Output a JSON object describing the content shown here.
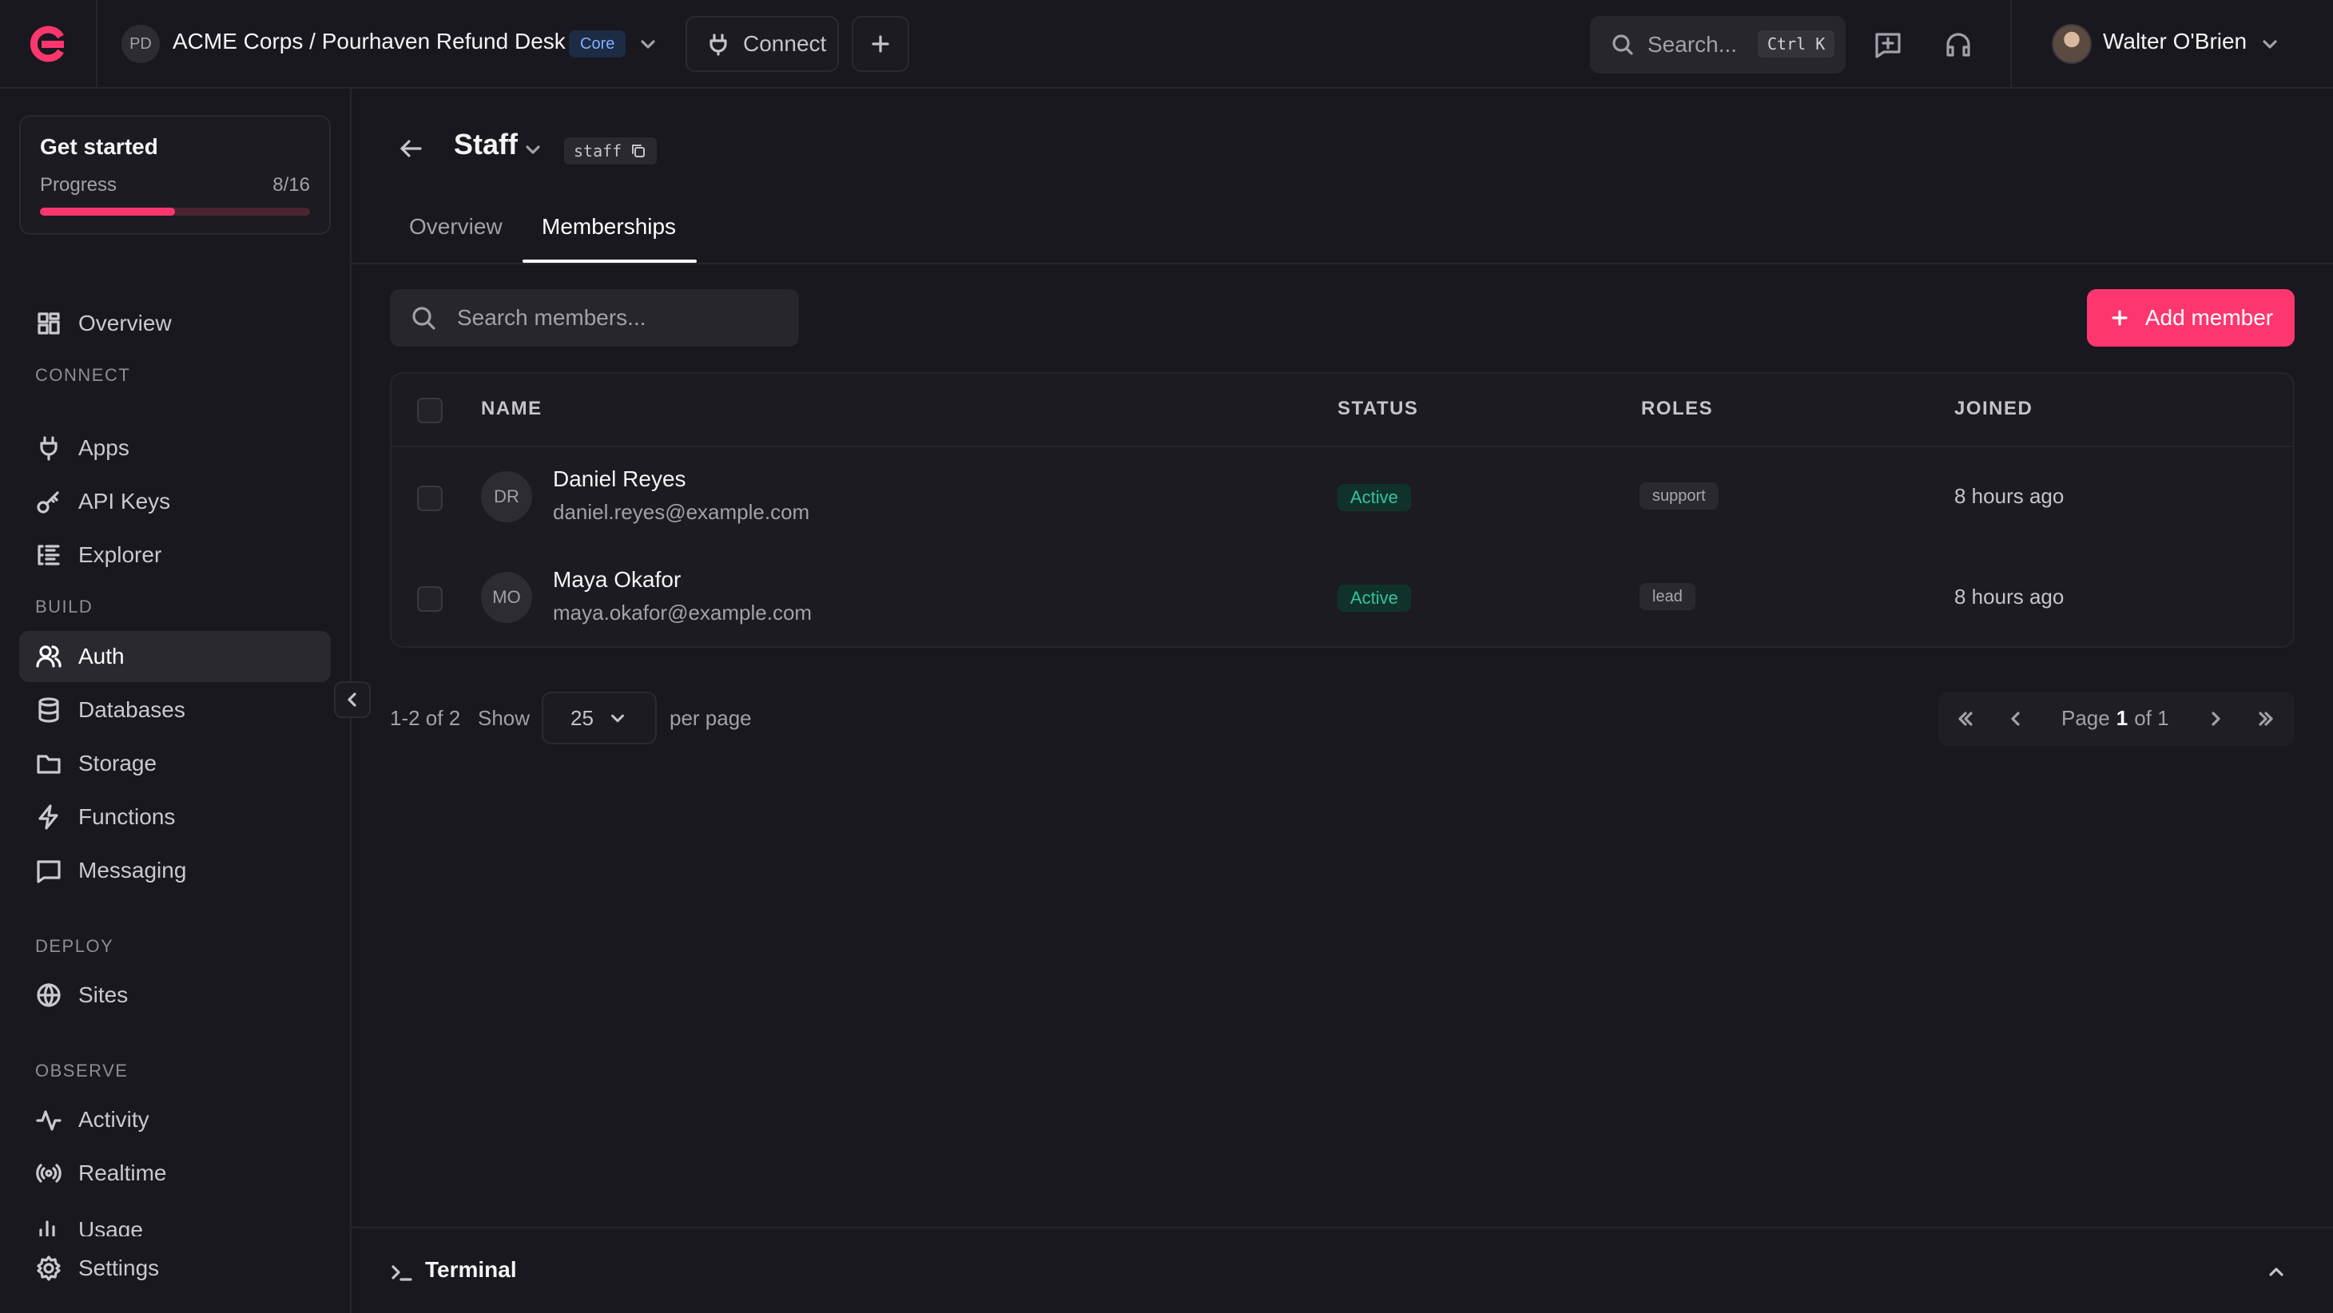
{
  "topbar": {
    "project_initials": "PD",
    "breadcrumb": "ACME Corps / Pourhaven Refund Desk",
    "plan_badge": "Core",
    "connect_label": "Connect",
    "search_placeholder": "Search...",
    "search_shortcut": "Ctrl K",
    "user_name": "Walter O'Brien"
  },
  "get_started": {
    "title": "Get started",
    "progress_label": "Progress",
    "progress_text": "8/16",
    "progress_fraction": 0.5
  },
  "sidebar": {
    "overview": "Overview",
    "sections": {
      "connect": "CONNECT",
      "build": "BUILD",
      "deploy": "DEPLOY",
      "observe": "OBSERVE"
    },
    "items": {
      "apps": "Apps",
      "api_keys": "API Keys",
      "explorer": "Explorer",
      "auth": "Auth",
      "databases": "Databases",
      "storage": "Storage",
      "functions": "Functions",
      "messaging": "Messaging",
      "sites": "Sites",
      "activity": "Activity",
      "realtime": "Realtime",
      "usage": "Usage",
      "settings": "Settings"
    },
    "active_item": "Auth"
  },
  "page": {
    "title": "Staff",
    "id_chip": "staff",
    "tabs": [
      "Overview",
      "Memberships"
    ],
    "active_tab": "Memberships"
  },
  "members": {
    "search_placeholder": "Search members...",
    "add_label": "Add member",
    "columns": [
      "NAME",
      "STATUS",
      "ROLES",
      "JOINED"
    ],
    "rows": [
      {
        "initials": "DR",
        "name": "Daniel Reyes",
        "email": "daniel.reyes@example.com",
        "status": "Active",
        "role": "support",
        "joined": "8 hours ago"
      },
      {
        "initials": "MO",
        "name": "Maya Okafor",
        "email": "maya.okafor@example.com",
        "status": "Active",
        "role": "lead",
        "joined": "8 hours ago"
      }
    ]
  },
  "pagination": {
    "range": "1-2 of 2",
    "show_label": "Show",
    "page_size": "25",
    "per_page_label": "per page",
    "page_label": "Page",
    "current_page": "1",
    "of_label": "of 1"
  },
  "terminal": {
    "label": "Terminal"
  },
  "colors": {
    "accent": "#fd366e",
    "background": "#19181e",
    "status_active": "#34c39a"
  }
}
